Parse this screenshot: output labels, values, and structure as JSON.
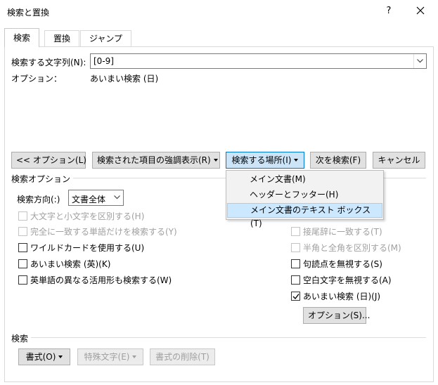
{
  "window": {
    "title": "検索と置換",
    "help": "?"
  },
  "tabs": [
    {
      "label": "検索"
    },
    {
      "label": "置換"
    },
    {
      "label": "ジャンプ"
    }
  ],
  "find": {
    "label": "検索する文字列(N):",
    "value": "[0-9]",
    "options_label": "オプション：",
    "options_value": "あいまい検索 (日)"
  },
  "buttons": {
    "less_options": "<< オプション(L)",
    "highlight": "検索された項目の強調表示(R)",
    "search_in": "検索する場所(I)",
    "find_next": "次を検索(F)",
    "cancel": "キャンセル",
    "options": "オプション(S)...",
    "format": "書式(O)",
    "special": "特殊文字(E)",
    "no_format": "書式の削除(T)"
  },
  "search_in_menu": [
    {
      "label": "メイン文書(M)"
    },
    {
      "label": "ヘッダーとフッター(H)"
    },
    {
      "label": "メイン文書のテキスト ボックス(T)"
    }
  ],
  "search_options": {
    "group_label": "検索オプション",
    "direction_label": "検索方向(:)",
    "direction_value": "文書全体",
    "left": [
      {
        "label": "大文字と小文字を区別する(H)",
        "checked": false,
        "enabled": false
      },
      {
        "label": "完全に一致する単語だけを検索する(Y)",
        "checked": false,
        "enabled": false
      },
      {
        "label": "ワイルドカードを使用する(U)",
        "checked": false,
        "enabled": true
      },
      {
        "label": "あいまい検索 (英)(K)",
        "checked": false,
        "enabled": true
      },
      {
        "label": "英単語の異なる活用形も検索する(W)",
        "checked": false,
        "enabled": true
      }
    ],
    "right": [
      {
        "label": "接尾辞に一致する(T)",
        "checked": false,
        "enabled": false
      },
      {
        "label": "半角と全角を区別する(M)",
        "checked": false,
        "enabled": false
      },
      {
        "label": "句読点を無視する(S)",
        "checked": false,
        "enabled": true
      },
      {
        "label": "空白文字を無視する(A)",
        "checked": false,
        "enabled": true
      },
      {
        "label": "あいまい検索 (日)(J)",
        "checked": true,
        "enabled": true
      }
    ]
  },
  "find_group": {
    "label": "検索"
  }
}
